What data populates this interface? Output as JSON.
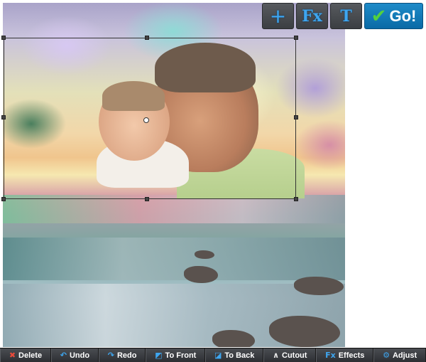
{
  "top_toolbar": {
    "add_label": "+",
    "effects_label": "Fx",
    "text_label": "T",
    "go_label": "Go!"
  },
  "bottom_toolbar": {
    "items": [
      {
        "label": "Delete",
        "icon": "x-icon"
      },
      {
        "label": "Undo",
        "icon": "undo-icon"
      },
      {
        "label": "Redo",
        "icon": "redo-icon"
      },
      {
        "label": "To Front",
        "icon": "to-front-icon"
      },
      {
        "label": "To Back",
        "icon": "to-back-icon"
      },
      {
        "label": "Cutout",
        "icon": "cutout-icon"
      },
      {
        "label": "Effects",
        "icon": "fx-icon"
      },
      {
        "label": "Adjust",
        "icon": "gear-icon"
      }
    ]
  },
  "colors": {
    "accent": "#3ea6f0",
    "go_button": "#1e8bc9",
    "toolbar": "#3b3e42"
  }
}
